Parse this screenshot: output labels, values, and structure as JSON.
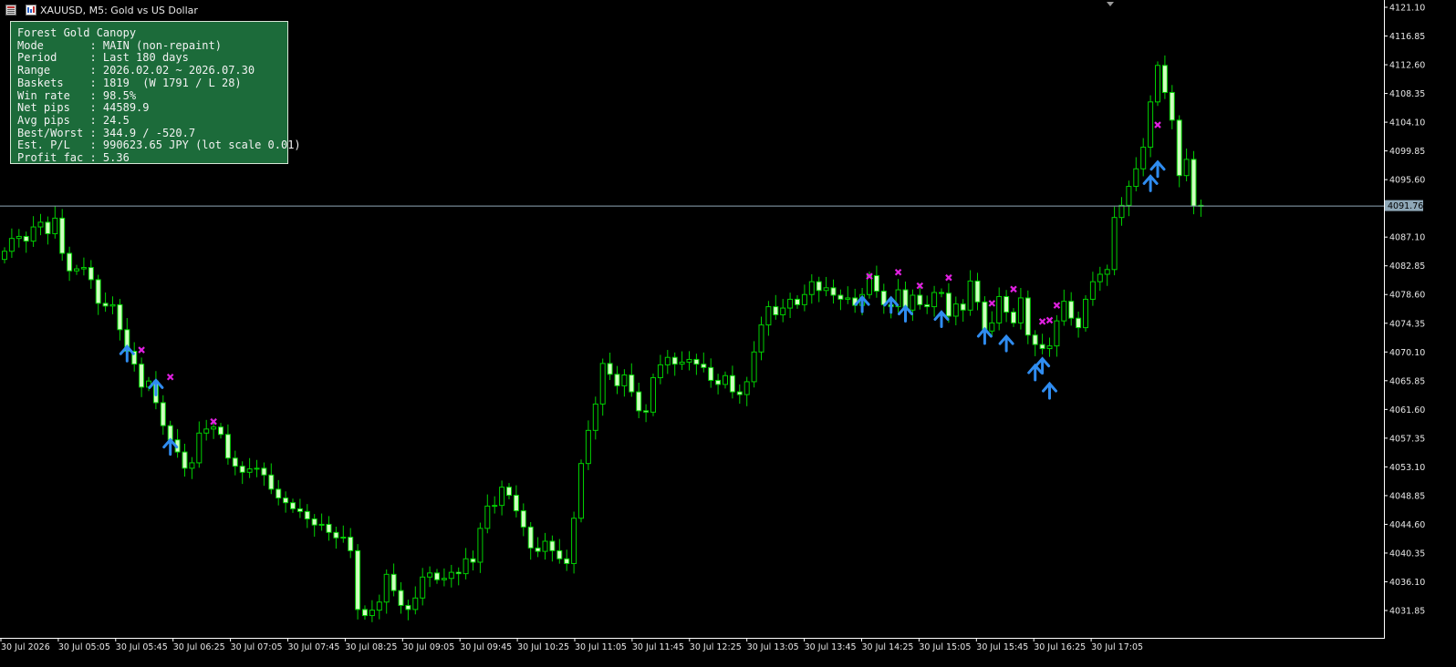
{
  "window": {
    "title": "XAUUSD, M5:  Gold vs US Dollar",
    "up_color": "#00d000",
    "body_fill": "#cfffc0",
    "background": "#000000",
    "buy_arrow_color": "#2f8cf0",
    "exit_cross_color": "#e020e0",
    "grid_line_color": "#8fa8b8"
  },
  "info_panel": {
    "rows": [
      "Forest Gold Canopy",
      "Mode       : MAIN (non-repaint)",
      "Period     : Last 180 days",
      "Range      : 2026.02.02 ~ 2026.07.30",
      "Baskets    : 1819  (W 1791 / L 28)",
      "Win rate   : 98.5%",
      "Net pips   : 44589.9",
      "Avg pips   : 24.5",
      "Best/Worst : 344.9 / -520.7",
      "Est. P/L   : 990623.65 JPY (lot scale 0.01)",
      "Profit fac : 5.36"
    ]
  },
  "chart_data": {
    "type": "candlestick",
    "symbol": "XAUUSD",
    "timeframe": "M5",
    "ylim": [
      4028.8,
      4121.2
    ],
    "price_ticks": [
      "4121.10",
      "4116.85",
      "4112.60",
      "4108.35",
      "4104.10",
      "4099.85",
      "4095.60",
      "4087.10",
      "4082.85",
      "4078.60",
      "4074.35",
      "4070.10",
      "4065.85",
      "4061.60",
      "4057.35",
      "4053.10",
      "4048.85",
      "4044.60",
      "4040.35",
      "4036.10",
      "4031.85"
    ],
    "current_price": "4091.76",
    "time_ticks": [
      "30 Jul 2026",
      "30 Jul 05:05",
      "30 Jul 05:45",
      "30 Jul 06:25",
      "30 Jul 07:05",
      "30 Jul 07:45",
      "30 Jul 08:25",
      "30 Jul 09:05",
      "30 Jul 09:45",
      "30 Jul 10:25",
      "30 Jul 11:05",
      "30 Jul 11:45",
      "30 Jul 12:25",
      "30 Jul 13:05",
      "30 Jul 13:45",
      "30 Jul 14:25",
      "30 Jul 15:05",
      "30 Jul 15:45",
      "30 Jul 16:25",
      "30 Jul 17:05"
    ],
    "candles_start": "30 Jul 2026",
    "bar_minutes": 5,
    "closes": [
      4085.0,
      4086.9,
      4087.2,
      4086.5,
      4088.6,
      4089.3,
      4087.6,
      4089.9,
      4084.7,
      4082.1,
      4082.4,
      4082.6,
      4080.8,
      4077.3,
      4076.9,
      4077.1,
      4073.4,
      4070.2,
      4068.3,
      4064.9,
      4065.8,
      4062.6,
      4059.2,
      4057.1,
      4055.3,
      4052.9,
      4053.7,
      4058.1,
      4058.7,
      4059.0,
      4057.9,
      4054.4,
      4053.2,
      4052.3,
      4052.8,
      4052.9,
      4051.9,
      4049.8,
      4048.5,
      4047.8,
      4046.9,
      4046.5,
      4045.4,
      4044.5,
      4044.6,
      4043.4,
      4042.6,
      4042.7,
      4040.7,
      4032.0,
      4031.1,
      4031.9,
      4033.1,
      4037.2,
      4034.8,
      4032.6,
      4032.0,
      4033.7,
      4036.8,
      4037.4,
      4036.4,
      4036.6,
      4037.5,
      4037.3,
      4039.5,
      4039.0,
      4044.0,
      4047.3,
      4047.4,
      4050.1,
      4048.9,
      4046.6,
      4044.2,
      4041.1,
      4040.6,
      4042.1,
      4040.7,
      4039.5,
      4038.8,
      4045.5,
      4053.6,
      4058.5,
      4062.4,
      4068.4,
      4066.8,
      4065.1,
      4066.7,
      4064.2,
      4061.4,
      4061.2,
      4066.3,
      4068.2,
      4069.3,
      4068.3,
      4068.6,
      4069.0,
      4068.3,
      4067.8,
      4065.9,
      4065.3,
      4066.6,
      4064.2,
      4063.8,
      4065.7,
      4070.1,
      4074.1,
      4076.8,
      4075.6,
      4076.6,
      4077.9,
      4077.1,
      4078.6,
      4080.5,
      4079.2,
      4079.6,
      4078.5,
      4077.9,
      4078.1,
      4077.0,
      4078.6,
      4081.4,
      4079.1,
      4077.1,
      4076.8,
      4079.3,
      4076.3,
      4078.5,
      4077.1,
      4076.8,
      4078.9,
      4078.8,
      4075.4,
      4077.2,
      4076.3,
      4080.6,
      4077.5,
      4073.2,
      4074.4,
      4078.3,
      4076.0,
      4074.4,
      4078.1,
      4072.6,
      4071.2,
      4070.6,
      4071.0,
      4074.7,
      4077.6,
      4075.1,
      4073.7,
      4077.9,
      4080.5,
      4081.6,
      4082.3,
      4090.0,
      4091.8,
      4094.6,
      4097.2,
      4100.4,
      4107.1,
      4112.5,
      4108.5,
      4104.4,
      4096.2,
      4098.6,
      4091.7,
      4091.8
    ],
    "markers": [
      {
        "type": "buy_arrow",
        "bar": 17,
        "price": 4070.1
      },
      {
        "type": "exit_cross",
        "bar": 19,
        "price": 4070.4
      },
      {
        "type": "buy_arrow",
        "bar": 21,
        "price": 4065.1
      },
      {
        "type": "exit_cross",
        "bar": 23,
        "price": 4066.4
      },
      {
        "type": "buy_arrow",
        "bar": 23,
        "price": 4056.3
      },
      {
        "type": "exit_cross",
        "bar": 29,
        "price": 4059.8
      },
      {
        "type": "exit_cross",
        "bar": 120,
        "price": 4081.3
      },
      {
        "type": "buy_arrow",
        "bar": 119,
        "price": 4077.4
      },
      {
        "type": "exit_cross",
        "bar": 124,
        "price": 4081.9
      },
      {
        "type": "buy_arrow",
        "bar": 123,
        "price": 4077.3
      },
      {
        "type": "buy_arrow",
        "bar": 125,
        "price": 4076.0
      },
      {
        "type": "exit_cross",
        "bar": 127,
        "price": 4079.9
      },
      {
        "type": "buy_arrow",
        "bar": 130,
        "price": 4075.2
      },
      {
        "type": "exit_cross",
        "bar": 131,
        "price": 4081.1
      },
      {
        "type": "buy_arrow",
        "bar": 136,
        "price": 4072.7
      },
      {
        "type": "exit_cross",
        "bar": 137,
        "price": 4077.3
      },
      {
        "type": "exit_cross",
        "bar": 140,
        "price": 4079.4
      },
      {
        "type": "buy_arrow",
        "bar": 139,
        "price": 4071.6
      },
      {
        "type": "buy_arrow",
        "bar": 143,
        "price": 4067.3
      },
      {
        "type": "exit_cross",
        "bar": 144,
        "price": 4074.6
      },
      {
        "type": "buy_arrow",
        "bar": 144,
        "price": 4068.3
      },
      {
        "type": "exit_cross",
        "bar": 145,
        "price": 4074.8
      },
      {
        "type": "buy_arrow",
        "bar": 145,
        "price": 4064.6
      },
      {
        "type": "exit_cross",
        "bar": 146,
        "price": 4077.0
      },
      {
        "type": "buy_arrow",
        "bar": 159,
        "price": 4095.3
      },
      {
        "type": "exit_cross",
        "bar": 160,
        "price": 4103.7
      },
      {
        "type": "buy_arrow",
        "bar": 160,
        "price": 4097.4
      }
    ]
  }
}
